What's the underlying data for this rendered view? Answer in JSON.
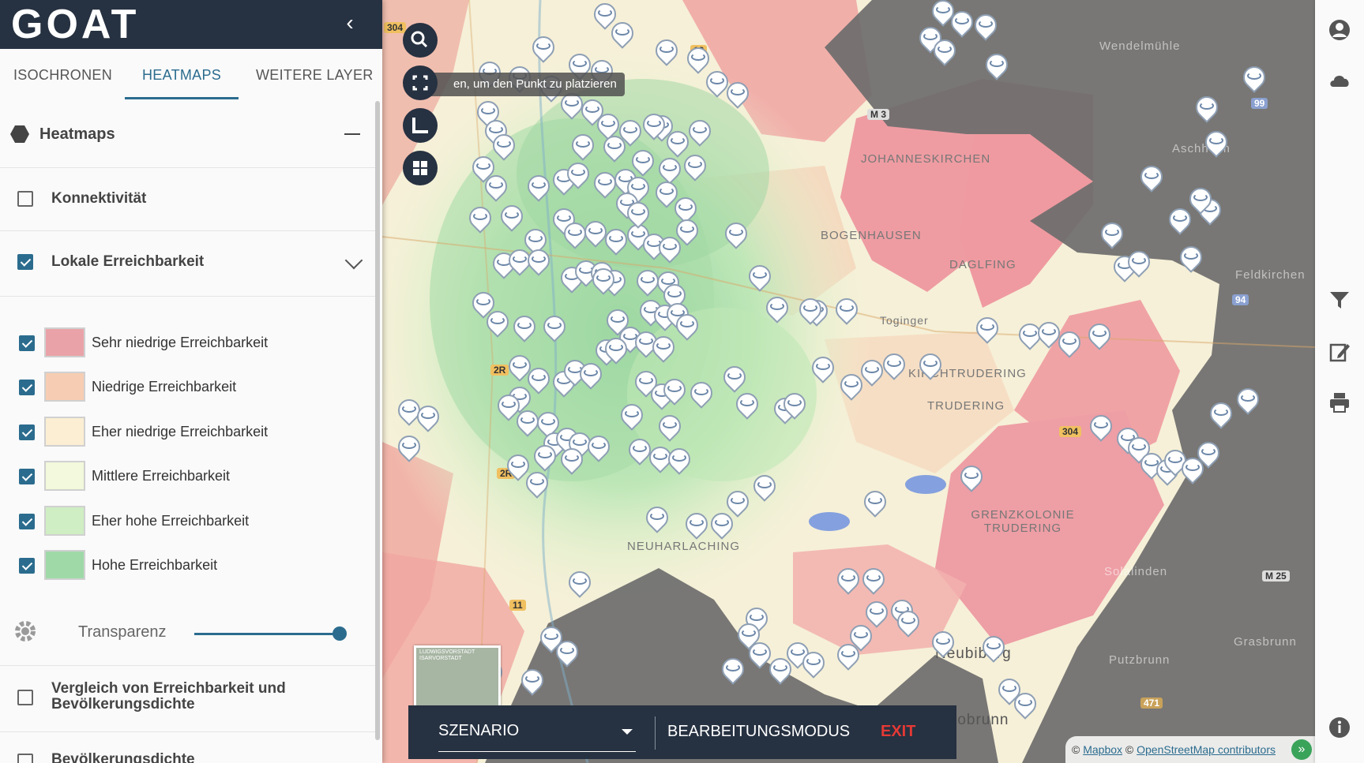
{
  "app": {
    "logo_text": "GOAT"
  },
  "tabs": [
    {
      "label": "ISOCHRONEN"
    },
    {
      "label": "HEATMAPS",
      "active": true
    },
    {
      "label": "WEITERE LAYER"
    }
  ],
  "heatmaps_section": {
    "title": "Heatmaps"
  },
  "layers": {
    "konnektivitaet": {
      "label": "Konnektivität",
      "checked": false
    },
    "lokale": {
      "label": "Lokale Erreichbarkeit",
      "checked": true
    },
    "vergleich": {
      "label": "Vergleich von Erreichbarkeit und Bevölkerungsdichte",
      "checked": false
    },
    "bevoelkerung": {
      "label": "Bevölkerungsdichte",
      "checked": false
    }
  },
  "legend": [
    {
      "label": "Sehr niedrige Erreichbarkeit",
      "color": "#e9a3a8",
      "checked": true
    },
    {
      "label": "Niedrige Erreichbarkeit",
      "color": "#f6cdb2",
      "checked": true
    },
    {
      "label": "Eher niedrige Erreichbarkeit",
      "color": "#fbeed3",
      "checked": true
    },
    {
      "label": "Mittlere Erreichbarkeit",
      "color": "#f2f9dc",
      "checked": true
    },
    {
      "label": "Eher hohe Erreichbarkeit",
      "color": "#cfeec3",
      "checked": true
    },
    {
      "label": "Hohe Erreichbarkeit",
      "color": "#9fd9a8",
      "checked": true
    }
  ],
  "transparency": {
    "label": "Transparenz",
    "value": 1.0
  },
  "map": {
    "tooltip": "en, um den Punkt zu platzieren",
    "minimap_label": "LUDWIGSVORSTADT ISARVORSTADT",
    "places": [
      {
        "name": "JOHANNESKIRCHEN"
      },
      {
        "name": "BOGENHAUSEN"
      },
      {
        "name": "DAGLFING"
      },
      {
        "name": "KIRCHTRUDERING"
      },
      {
        "name": "TRUDERING"
      },
      {
        "name": "GRENZKOLONIE TRUDERING"
      },
      {
        "name": "NEUHARLACHING"
      },
      {
        "name": "Wendelmühle"
      },
      {
        "name": "Solalinden"
      },
      {
        "name": "Putzbrunn"
      },
      {
        "name": "Grasbrunn"
      },
      {
        "name": "Neubiberg"
      },
      {
        "name": "Ottobrunn"
      },
      {
        "name": "Toginger"
      },
      {
        "name": "Feldkirchen"
      },
      {
        "name": "Aschheim"
      }
    ],
    "road_shields": [
      "304",
      "13",
      "M 3",
      "2R",
      "2R",
      "11",
      "304",
      "M 25",
      "99",
      "94",
      "471"
    ]
  },
  "bottom_bar": {
    "scenario_label": "SZENARIO",
    "edit_mode_label": "BEARBEITUNGSMODUS",
    "exit_label": "EXIT"
  },
  "attribution": {
    "mapbox": "Mapbox",
    "osm": "OpenStreetMap contributors",
    "copyright": "©"
  },
  "colors": {
    "primary": "#263141",
    "accent": "#2b6c8e",
    "exit": "#e53935"
  }
}
